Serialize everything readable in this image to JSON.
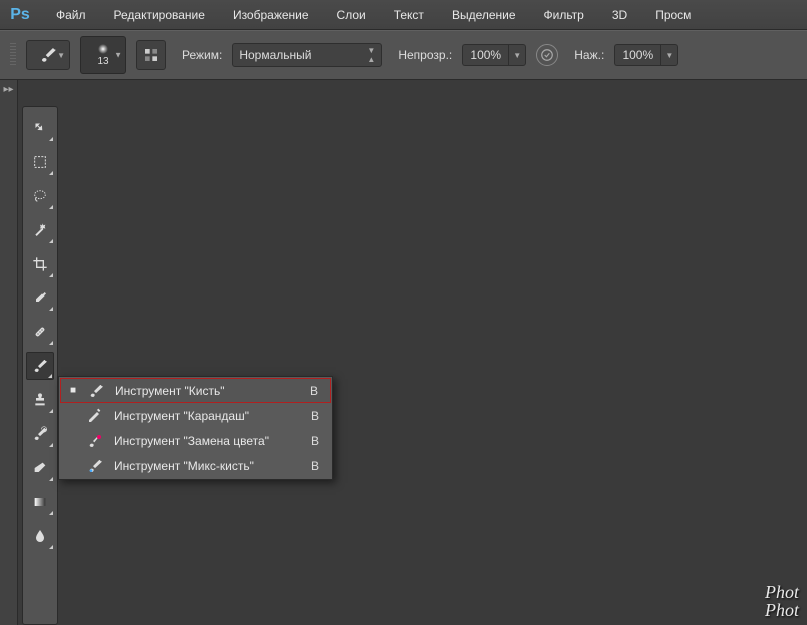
{
  "app": {
    "logo": "Ps"
  },
  "menubar": {
    "items": [
      "Файл",
      "Редактирование",
      "Изображение",
      "Слои",
      "Текст",
      "Выделение",
      "Фильтр",
      "3D",
      "Просм"
    ]
  },
  "options": {
    "brush_size": "13",
    "mode_label": "Режим:",
    "mode_value": "Нормальный",
    "opacity_label": "Непрозр.:",
    "opacity_value": "100%",
    "flow_label": "Наж.:",
    "flow_value": "100%"
  },
  "tools": {
    "items": [
      {
        "id": "move",
        "icon": "move"
      },
      {
        "id": "marquee",
        "icon": "marquee"
      },
      {
        "id": "lasso",
        "icon": "lasso"
      },
      {
        "id": "wand",
        "icon": "wand"
      },
      {
        "id": "crop",
        "icon": "crop"
      },
      {
        "id": "eyedropper",
        "icon": "eyedropper"
      },
      {
        "id": "heal",
        "icon": "heal"
      },
      {
        "id": "brush",
        "icon": "brush",
        "active": true
      },
      {
        "id": "stamp",
        "icon": "stamp"
      },
      {
        "id": "history",
        "icon": "history"
      },
      {
        "id": "eraser",
        "icon": "eraser"
      },
      {
        "id": "gradient",
        "icon": "gradient"
      },
      {
        "id": "blur",
        "icon": "blur"
      }
    ]
  },
  "flyout": {
    "items": [
      {
        "label": "Инструмент \"Кисть\"",
        "shortcut": "B",
        "icon": "brush",
        "selected": true
      },
      {
        "label": "Инструмент \"Карандаш\"",
        "shortcut": "B",
        "icon": "pencil",
        "selected": false
      },
      {
        "label": "Инструмент \"Замена цвета\"",
        "shortcut": "B",
        "icon": "color-replace",
        "selected": false
      },
      {
        "label": "Инструмент \"Микс-кисть\"",
        "shortcut": "B",
        "icon": "mixer",
        "selected": false
      }
    ]
  },
  "watermark": {
    "line1": "Phot",
    "line2": "Phot"
  }
}
